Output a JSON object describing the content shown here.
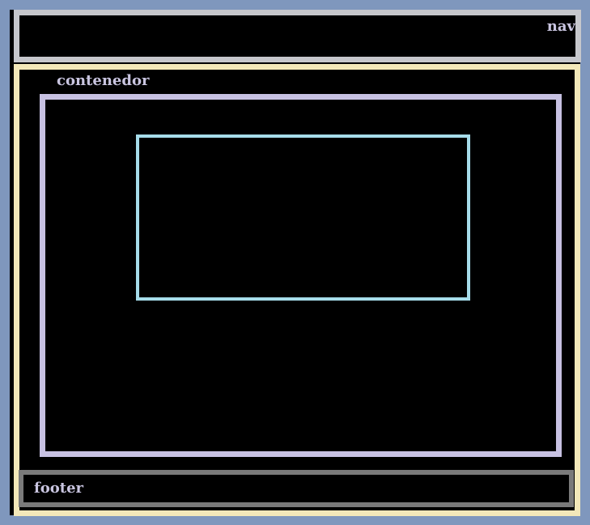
{
  "nav": {
    "label": "nav"
  },
  "contenedor": {
    "label": "contenedor"
  },
  "footer": {
    "label": "footer"
  },
  "colors": {
    "page_frame": "#7f97bd",
    "nav_border": "#c6c7cc",
    "main_border": "#f3e8b9",
    "contenedor_border": "#c7c1e2",
    "inner_box_border": "#a6dcea",
    "footer_border": "#7a7a7a",
    "label_text": "#c9c5e0",
    "background": "#000000"
  }
}
